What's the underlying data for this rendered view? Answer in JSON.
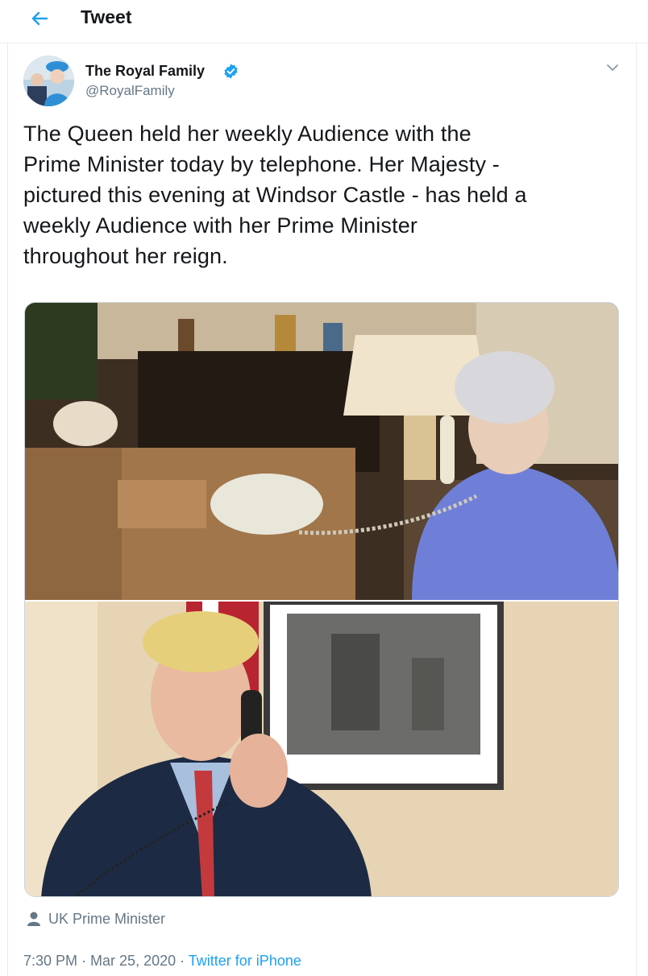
{
  "header": {
    "title": "Tweet",
    "back_icon": "back-arrow-icon"
  },
  "author": {
    "display_name": "The Royal Family",
    "handle": "@RoyalFamily",
    "verified": true
  },
  "tweet": {
    "lines": [
      "The Queen held her weekly Audience with the",
      "Prime Minister today by telephone. Her Majesty -",
      "pictured this evening at Windsor Castle - has held a",
      "weekly Audience with her Prime Minister",
      "throughout her reign."
    ]
  },
  "media": {
    "photos": [
      {
        "alt": "The Queen on the telephone at Windsor Castle"
      },
      {
        "alt": "Prime Minister on the telephone"
      }
    ]
  },
  "location": {
    "label": "UK Prime Minister"
  },
  "meta": {
    "time": "7:30 PM",
    "separator": " · ",
    "date": "Mar 25, 2020",
    "source": "Twitter for iPhone"
  },
  "colors": {
    "accent": "#1da1f2",
    "secondary_text": "#657786",
    "border": "#e6ecf0"
  }
}
